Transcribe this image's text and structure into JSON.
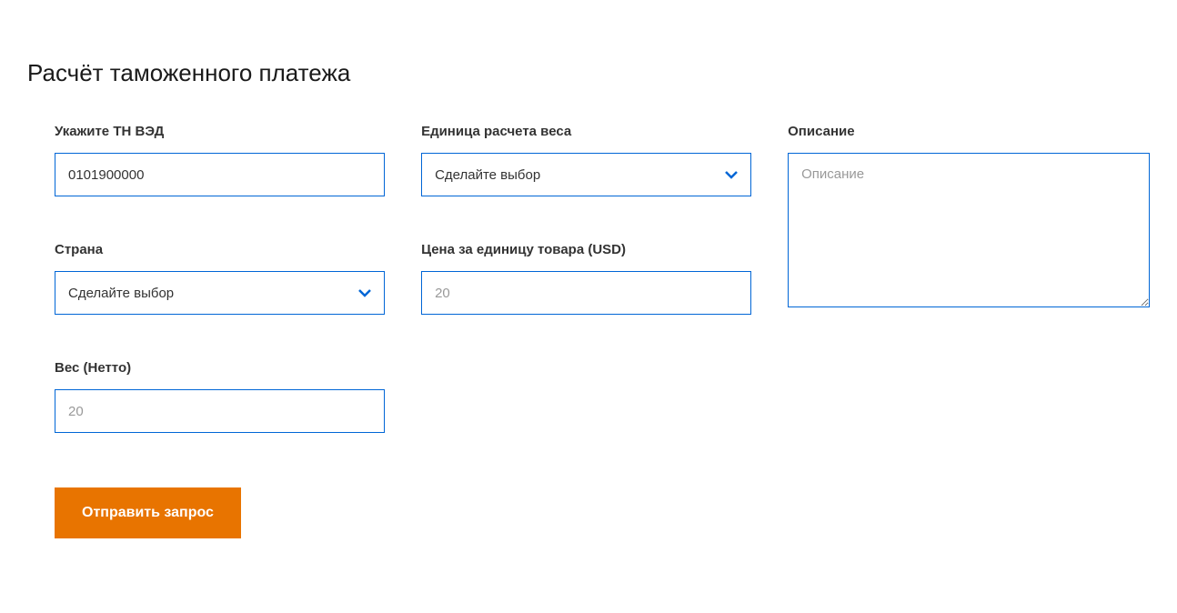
{
  "page_title": "Расчёт таможенного платежа",
  "fields": {
    "tn_ved": {
      "label": "Укажите ТН ВЭД",
      "value": "0101900000"
    },
    "country": {
      "label": "Страна",
      "selected": "Сделайте выбор"
    },
    "weight_net": {
      "label": "Вес (Нетто)",
      "value": "20"
    },
    "weight_unit": {
      "label": "Единица расчета веса",
      "selected": "Сделайте выбор"
    },
    "price_per_unit": {
      "label": "Цена за единицу товара (USD)",
      "value": "20"
    },
    "description": {
      "label": "Описание",
      "placeholder": "Описание"
    }
  },
  "submit_label": "Отправить запрос"
}
